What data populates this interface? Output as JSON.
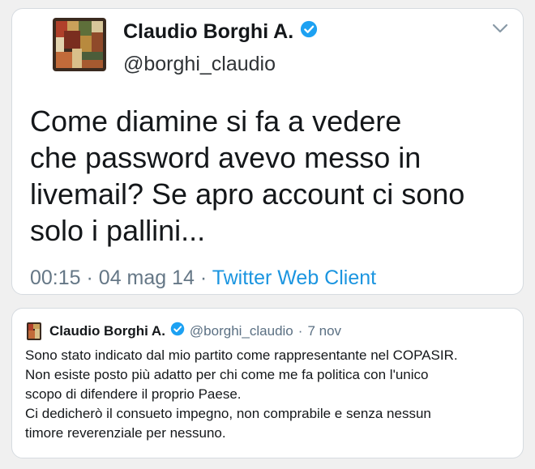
{
  "tweet": {
    "author_name": "Claudio Borghi A.",
    "author_handle": "@borghi_claudio",
    "text_lines": [
      "Come diamine si fa a vedere",
      "che password avevo messo in",
      "livemail? Se apro account ci sono",
      "solo i pallini..."
    ],
    "time": "00:15",
    "sep1": "·",
    "date": "04 mag 14",
    "sep2": "·",
    "client": "Twitter Web Client"
  },
  "quote": {
    "author_name": "Claudio Borghi A.",
    "author_handle": "@borghi_claudio",
    "sep": "·",
    "date": "7 nov",
    "text_lines": [
      "Sono stato indicato dal mio partito come rappresentante nel COPASIR.",
      "Non esiste posto più adatto per chi come me fa politica con l'unico",
      "scopo di difendere il proprio Paese.",
      "Ci dedicherò il consueto impegno, non comprabile e senza nessun",
      "timore reverenziale per nessuno."
    ]
  },
  "icons": {
    "verified": "verified-badge-icon",
    "more": "chevron-down-icon"
  },
  "colors": {
    "link": "#1b95e0",
    "verified": "#1da1f2",
    "text": "#14171a",
    "muted": "#657786"
  }
}
